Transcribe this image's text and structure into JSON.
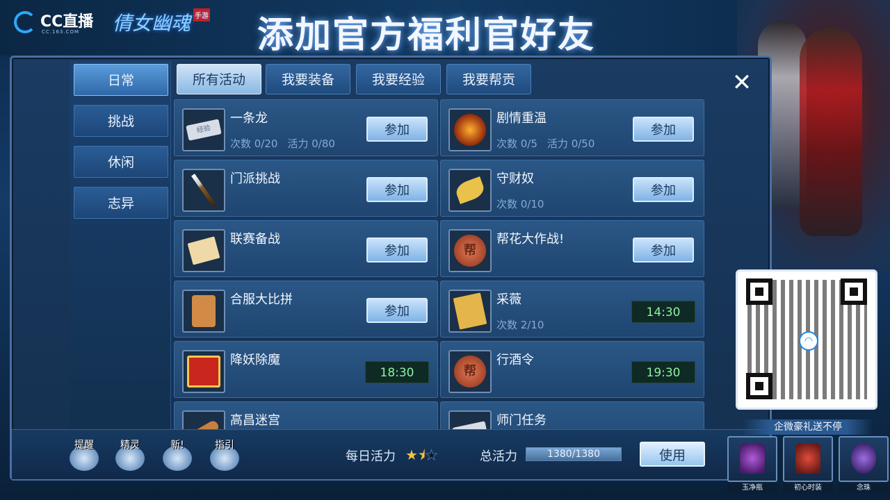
{
  "banner": {
    "platform_logo": "CC直播",
    "platform_sub": "CC.163.COM",
    "game_logo": "倩女幽魂",
    "game_logo_tag": "手游",
    "headline": "添加官方福利官好友"
  },
  "sidebar": {
    "items": [
      {
        "label": "日常",
        "active": true
      },
      {
        "label": "挑战",
        "active": false
      },
      {
        "label": "休闲",
        "active": false
      },
      {
        "label": "志异",
        "active": false
      }
    ]
  },
  "tabs": [
    {
      "label": "所有活动",
      "active": true
    },
    {
      "label": "我要装备",
      "active": false
    },
    {
      "label": "我要经验",
      "active": false
    },
    {
      "label": "我要帮贡",
      "active": false
    }
  ],
  "activities": [
    {
      "name": "一条龙",
      "count": "次数 0/20",
      "vitality": "活力 0/80",
      "action": "参加",
      "icon": "ticket-icon",
      "icon_text": "经验"
    },
    {
      "name": "剧情重温",
      "count": "次数 0/5",
      "vitality": "活力 0/50",
      "action": "参加",
      "icon": "mask-icon"
    },
    {
      "name": "门派挑战",
      "count": "",
      "vitality": "",
      "action": "参加",
      "icon": "brush-icon"
    },
    {
      "name": "守财奴",
      "count": "次数 0/10",
      "vitality": "",
      "action": "参加",
      "icon": "leaf-icon"
    },
    {
      "name": "联赛备战",
      "count": "",
      "vitality": "",
      "action": "参加",
      "icon": "paper-icon"
    },
    {
      "name": "帮花大作战!",
      "count": "",
      "vitality": "",
      "action": "参加",
      "icon": "coin-icon",
      "icon_text": "帮"
    },
    {
      "name": "合服大比拼",
      "count": "",
      "vitality": "",
      "action": "参加",
      "icon": "token-icon"
    },
    {
      "name": "采薇",
      "count": "次数 2/10",
      "vitality": "",
      "time": "14:30",
      "icon": "book-icon"
    },
    {
      "name": "降妖除魔",
      "count": "",
      "vitality": "",
      "time": "18:30",
      "icon": "gift-icon"
    },
    {
      "name": "行酒令",
      "count": "",
      "vitality": "",
      "time": "19:30",
      "icon": "coin-icon",
      "icon_text": "帮"
    },
    {
      "name": "高昌迷宫",
      "count": "",
      "vitality": "",
      "icon": "scroll-icon"
    },
    {
      "name": "师门任务",
      "count": "",
      "vitality": "",
      "icon": "ticket-icon"
    }
  ],
  "toolbar": {
    "tools": [
      "提醒",
      "精灵",
      "新!",
      "指引"
    ],
    "daily_vitality_label": "每日活力",
    "stars_full": 1,
    "stars_half": 1,
    "stars_empty": 1,
    "total_vitality_label": "总活力",
    "total_vitality_value": "1380/1380",
    "total_vitality_fraction": 1.0,
    "use_label": "使用"
  },
  "promo": {
    "title": "企微豪礼送不停",
    "rewards": [
      "玉净瓶",
      "初心时装",
      "念珠"
    ]
  },
  "colors": {
    "accent": "#5b9cdc",
    "timer_green": "#8ff0a4",
    "panel": "#1f4570"
  }
}
